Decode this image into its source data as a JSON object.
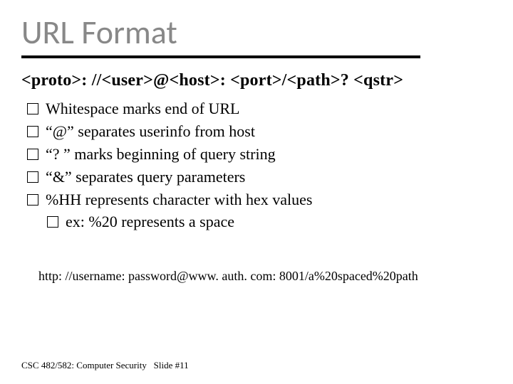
{
  "title": "URL Format",
  "url_format": "<proto>: //<user>@<host>: <port>/<path>? <qstr>",
  "bullets": [
    "Whitespace marks end of URL",
    "“@” separates userinfo from host",
    "“? ” marks beginning of query string",
    "“&” separates query parameters",
    "%HH represents character with hex values"
  ],
  "sub_bullets": [
    "ex: %20 represents a space"
  ],
  "example": "http: //username: password@www. auth. com: 8001/a%20spaced%20path",
  "footer": "CSC 482/582: Computer Security   Slide #11"
}
